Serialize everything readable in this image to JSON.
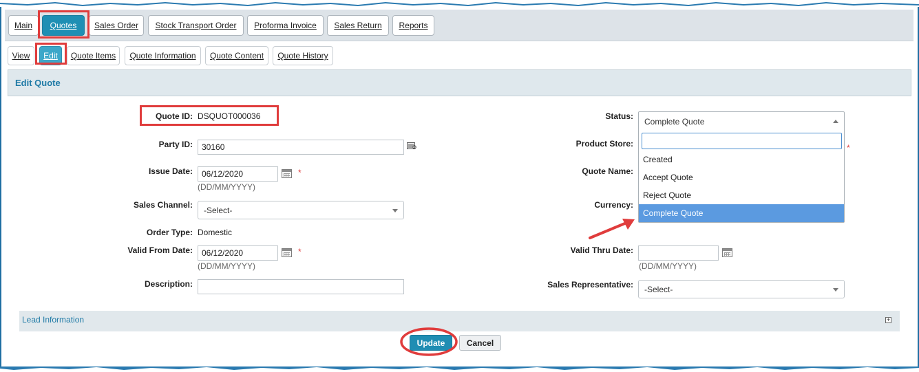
{
  "top_tabs": [
    {
      "label": "Main"
    },
    {
      "label": "Quotes"
    },
    {
      "label": "Sales Order"
    },
    {
      "label": "Stock Transport Order"
    },
    {
      "label": "Proforma Invoice"
    },
    {
      "label": "Sales Return"
    },
    {
      "label": "Reports"
    }
  ],
  "sub_tabs": [
    {
      "label": "View"
    },
    {
      "label": "Edit"
    },
    {
      "label": "Quote Items"
    },
    {
      "label": "Quote Information"
    },
    {
      "label": "Quote Content"
    },
    {
      "label": "Quote History"
    }
  ],
  "section_title": "Edit Quote",
  "form": {
    "quote_id_label": "Quote ID:",
    "quote_id_value": "DSQUOT000036",
    "party_id_label": "Party ID:",
    "party_id_value": "30160",
    "issue_date_label": "Issue Date:",
    "issue_date_value": "06/12/2020",
    "date_format": "(DD/MM/YYYY)",
    "sales_channel_label": "Sales Channel:",
    "sales_channel_value": "-Select-",
    "order_type_label": "Order Type:",
    "order_type_value": "Domestic",
    "valid_from_label": "Valid From Date:",
    "valid_from_value": "06/12/2020",
    "description_label": "Description:",
    "description_value": "",
    "status_label": "Status:",
    "status_value": "Complete Quote",
    "product_store_label": "Product Store:",
    "quote_name_label": "Quote Name:",
    "currency_label": "Currency:",
    "valid_thru_label": "Valid Thru Date:",
    "valid_thru_value": "",
    "sales_rep_label": "Sales Representative:",
    "sales_rep_value": "-Select-",
    "required_mark": "*"
  },
  "status_dropdown": {
    "search_value": "",
    "options": [
      "Created",
      "Accept Quote",
      "Reject Quote",
      "Complete Quote"
    ],
    "selected": "Complete Quote"
  },
  "lead_info_label": "Lead Information",
  "expand_symbol": "+",
  "buttons": {
    "update": "Update",
    "cancel": "Cancel"
  },
  "colors": {
    "accent": "#1e8fb4",
    "highlight": "#e03c3c",
    "header_text": "#1f7aa6",
    "selected_option": "#5b9ae0"
  },
  "icons": [
    "calendar-icon",
    "lookup-icon",
    "caret-down-icon",
    "caret-up-icon",
    "expand-icon",
    "arrow-annotation-icon"
  ]
}
